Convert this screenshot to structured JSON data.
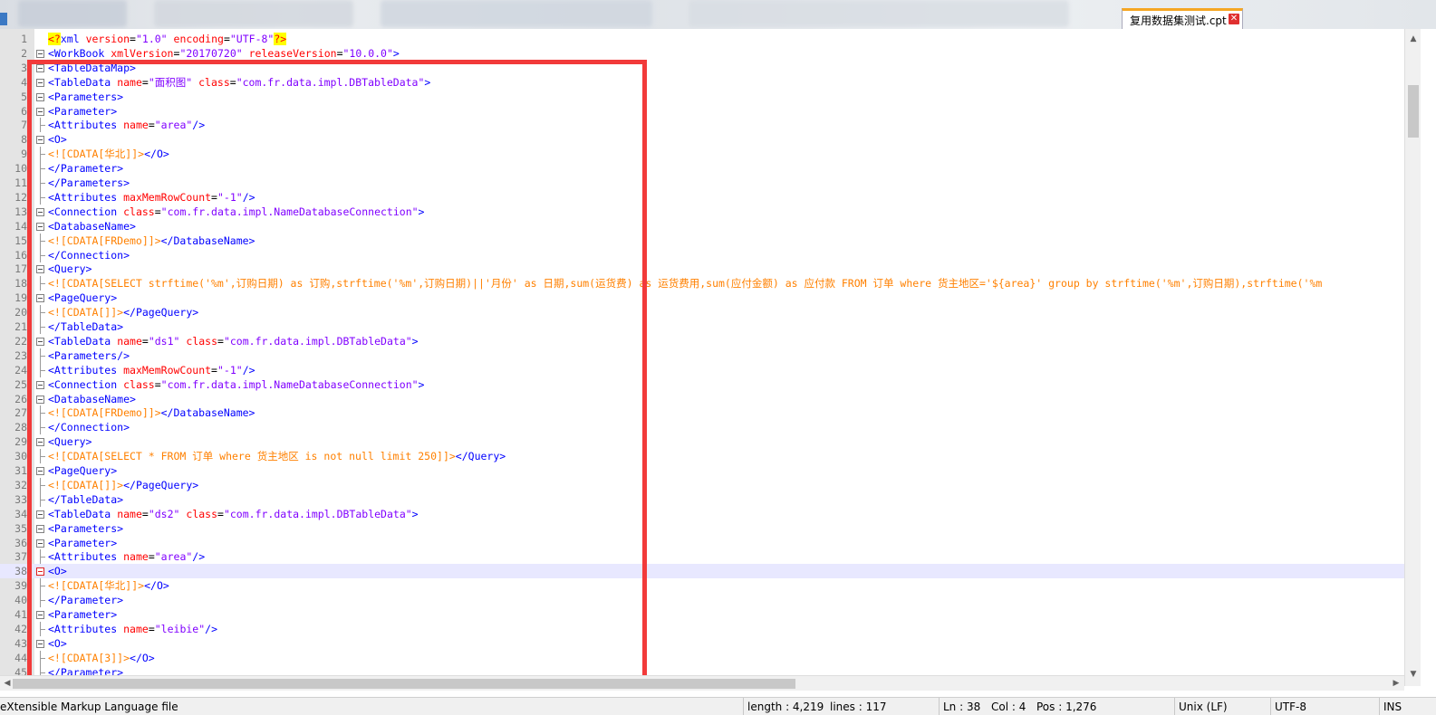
{
  "tab": {
    "title": "复用数据集测试.cpt",
    "close_glyph": "✕"
  },
  "editor": {
    "lines": [
      {
        "n": "1",
        "html": "<span class=\"decl\">&lt;?</span><span class=\"tag\">xml</span> <span class=\"attr\">version</span>=<span class=\"val\">\"1.0\"</span> <span class=\"attr\">encoding</span>=<span class=\"val\">\"UTF-8\"</span><span class=\"decl\">?&gt;</span>"
      },
      {
        "n": "2",
        "html": "<span class=\"tag\">&lt;WorkBook</span> <span class=\"attr\">xmlVersion</span>=<span class=\"val\">\"20170720\"</span> <span class=\"attr\">releaseVersion</span>=<span class=\"val\">\"10.0.0\"</span><span class=\"tag\">&gt;</span>"
      },
      {
        "n": "3",
        "html": "<span class=\"tag\">&lt;TableDataMap&gt;</span>"
      },
      {
        "n": "4",
        "html": "<span class=\"tag\">&lt;TableData</span> <span class=\"attr\">name</span>=<span class=\"val\">\"面积图\"</span> <span class=\"attr\">class</span>=<span class=\"val\">\"com.fr.data.impl.DBTableData\"</span><span class=\"tag\">&gt;</span>"
      },
      {
        "n": "5",
        "html": "<span class=\"tag\">&lt;Parameters&gt;</span>"
      },
      {
        "n": "6",
        "html": "<span class=\"tag\">&lt;Parameter&gt;</span>"
      },
      {
        "n": "7",
        "html": "<span class=\"tag\">&lt;Attributes</span> <span class=\"attr\">name</span>=<span class=\"val\">\"area\"</span><span class=\"tag\">/&gt;</span>"
      },
      {
        "n": "8",
        "html": "<span class=\"tag\">&lt;O&gt;</span>"
      },
      {
        "n": "9",
        "html": "<span class=\"cdata\">&lt;![CDATA[华北]]&gt;</span><span class=\"tag\">&lt;/O&gt;</span>"
      },
      {
        "n": "10",
        "html": "<span class=\"tag\">&lt;/Parameter&gt;</span>"
      },
      {
        "n": "11",
        "html": "<span class=\"tag\">&lt;/Parameters&gt;</span>"
      },
      {
        "n": "12",
        "html": "<span class=\"tag\">&lt;Attributes</span> <span class=\"attr\">maxMemRowCount</span>=<span class=\"val\">\"-1\"</span><span class=\"tag\">/&gt;</span>"
      },
      {
        "n": "13",
        "html": "<span class=\"tag\">&lt;Connection</span> <span class=\"attr\">class</span>=<span class=\"val\">\"com.fr.data.impl.NameDatabaseConnection\"</span><span class=\"tag\">&gt;</span>"
      },
      {
        "n": "14",
        "html": "<span class=\"tag\">&lt;DatabaseName&gt;</span>"
      },
      {
        "n": "15",
        "html": "<span class=\"cdata\">&lt;![CDATA[FRDemo]]&gt;</span><span class=\"tag\">&lt;/DatabaseName&gt;</span>"
      },
      {
        "n": "16",
        "html": "<span class=\"tag\">&lt;/Connection&gt;</span>"
      },
      {
        "n": "17",
        "html": "<span class=\"tag\">&lt;Query&gt;</span>"
      },
      {
        "n": "18",
        "html": "<span class=\"cdata\">&lt;![CDATA[SELECT strftime('%m',订购日期) as 订购,strftime('%m',订购日期)||'月份' as 日期,sum(运货费) as 运货费用,sum(应付金额) as 应付款 FROM 订单 where 货主地区='${area}' group by strftime('%m',订购日期),strftime('%m</span>"
      },
      {
        "n": "19",
        "html": "<span class=\"tag\">&lt;PageQuery&gt;</span>"
      },
      {
        "n": "20",
        "html": "<span class=\"cdata\">&lt;![CDATA[]]&gt;</span><span class=\"tag\">&lt;/PageQuery&gt;</span>"
      },
      {
        "n": "21",
        "html": "<span class=\"tag\">&lt;/TableData&gt;</span>"
      },
      {
        "n": "22",
        "html": "<span class=\"tag\">&lt;TableData</span> <span class=\"attr\">name</span>=<span class=\"val\">\"ds1\"</span> <span class=\"attr\">class</span>=<span class=\"val\">\"com.fr.data.impl.DBTableData\"</span><span class=\"tag\">&gt;</span>"
      },
      {
        "n": "23",
        "html": "<span class=\"tag\">&lt;Parameters/&gt;</span>"
      },
      {
        "n": "24",
        "html": "<span class=\"tag\">&lt;Attributes</span> <span class=\"attr\">maxMemRowCount</span>=<span class=\"val\">\"-1\"</span><span class=\"tag\">/&gt;</span>"
      },
      {
        "n": "25",
        "html": "<span class=\"tag\">&lt;Connection</span> <span class=\"attr\">class</span>=<span class=\"val\">\"com.fr.data.impl.NameDatabaseConnection\"</span><span class=\"tag\">&gt;</span>"
      },
      {
        "n": "26",
        "html": "<span class=\"tag\">&lt;DatabaseName&gt;</span>"
      },
      {
        "n": "27",
        "html": "<span class=\"cdata\">&lt;![CDATA[FRDemo]]&gt;</span><span class=\"tag\">&lt;/DatabaseName&gt;</span>"
      },
      {
        "n": "28",
        "html": "<span class=\"tag\">&lt;/Connection&gt;</span>"
      },
      {
        "n": "29",
        "html": "<span class=\"tag\">&lt;Query&gt;</span>"
      },
      {
        "n": "30",
        "html": "<span class=\"cdata\">&lt;![CDATA[SELECT * FROM 订单 where 货主地区 is not null limit 250]]&gt;</span><span class=\"tag\">&lt;/Query&gt;</span>"
      },
      {
        "n": "31",
        "html": "<span class=\"tag\">&lt;PageQuery&gt;</span>"
      },
      {
        "n": "32",
        "html": "<span class=\"cdata\">&lt;![CDATA[]]&gt;</span><span class=\"tag\">&lt;/PageQuery&gt;</span>"
      },
      {
        "n": "33",
        "html": "<span class=\"tag\">&lt;/TableData&gt;</span>"
      },
      {
        "n": "34",
        "html": "<span class=\"tag\">&lt;TableData</span> <span class=\"attr\">name</span>=<span class=\"val\">\"ds2\"</span> <span class=\"attr\">class</span>=<span class=\"val\">\"com.fr.data.impl.DBTableData\"</span><span class=\"tag\">&gt;</span>"
      },
      {
        "n": "35",
        "html": "<span class=\"tag\">&lt;Parameters&gt;</span>"
      },
      {
        "n": "36",
        "html": "<span class=\"tag\">&lt;Parameter&gt;</span>"
      },
      {
        "n": "37",
        "html": "<span class=\"tag\">&lt;Attributes</span> <span class=\"attr\">name</span>=<span class=\"val\">\"area\"</span><span class=\"tag\">/&gt;</span>"
      },
      {
        "n": "38",
        "html": "<span class=\"tag\">&lt;O&gt;</span>"
      },
      {
        "n": "39",
        "html": "<span class=\"cdata\">&lt;![CDATA[华北]]&gt;</span><span class=\"tag\">&lt;/O&gt;</span>"
      },
      {
        "n": "40",
        "html": "<span class=\"tag\">&lt;/Parameter&gt;</span>"
      },
      {
        "n": "41",
        "html": "<span class=\"tag\">&lt;Parameter&gt;</span>"
      },
      {
        "n": "42",
        "html": "<span class=\"tag\">&lt;Attributes</span> <span class=\"attr\">name</span>=<span class=\"val\">\"leibie\"</span><span class=\"tag\">/&gt;</span>"
      },
      {
        "n": "43",
        "html": "<span class=\"tag\">&lt;O&gt;</span>"
      },
      {
        "n": "44",
        "html": "<span class=\"cdata\">&lt;![CDATA[3]]&gt;</span><span class=\"tag\">&lt;/O&gt;</span>"
      },
      {
        "n": "45",
        "html": "<span class=\"tag\">&lt;/Parameter&gt;</span>"
      }
    ],
    "fold_start_lines": [
      2,
      3,
      4,
      5,
      6,
      8,
      13,
      14,
      17,
      19,
      22,
      25,
      26,
      29,
      31,
      34,
      35,
      36,
      38,
      41,
      43
    ],
    "current_line": 38
  },
  "scroll": {
    "up_arrow": "▲",
    "down_arrow": "▼",
    "left_arrow": "◀",
    "right_arrow": "▶"
  },
  "statusbar": {
    "file_type": "eXtensible Markup Language file",
    "length": "length : 4,219",
    "lines": "lines : 117",
    "ln": "Ln : 38",
    "col": "Col : 4",
    "pos": "Pos : 1,276",
    "eol": "Unix (LF)",
    "encoding": "UTF-8",
    "mode": "INS"
  },
  "colors": {
    "tag": "#0000ff",
    "attr": "#ff0000",
    "value": "#8000ff",
    "cdata": "#ff8000",
    "annotation": "#f23a3a",
    "tab_accent": "#f5a623"
  }
}
